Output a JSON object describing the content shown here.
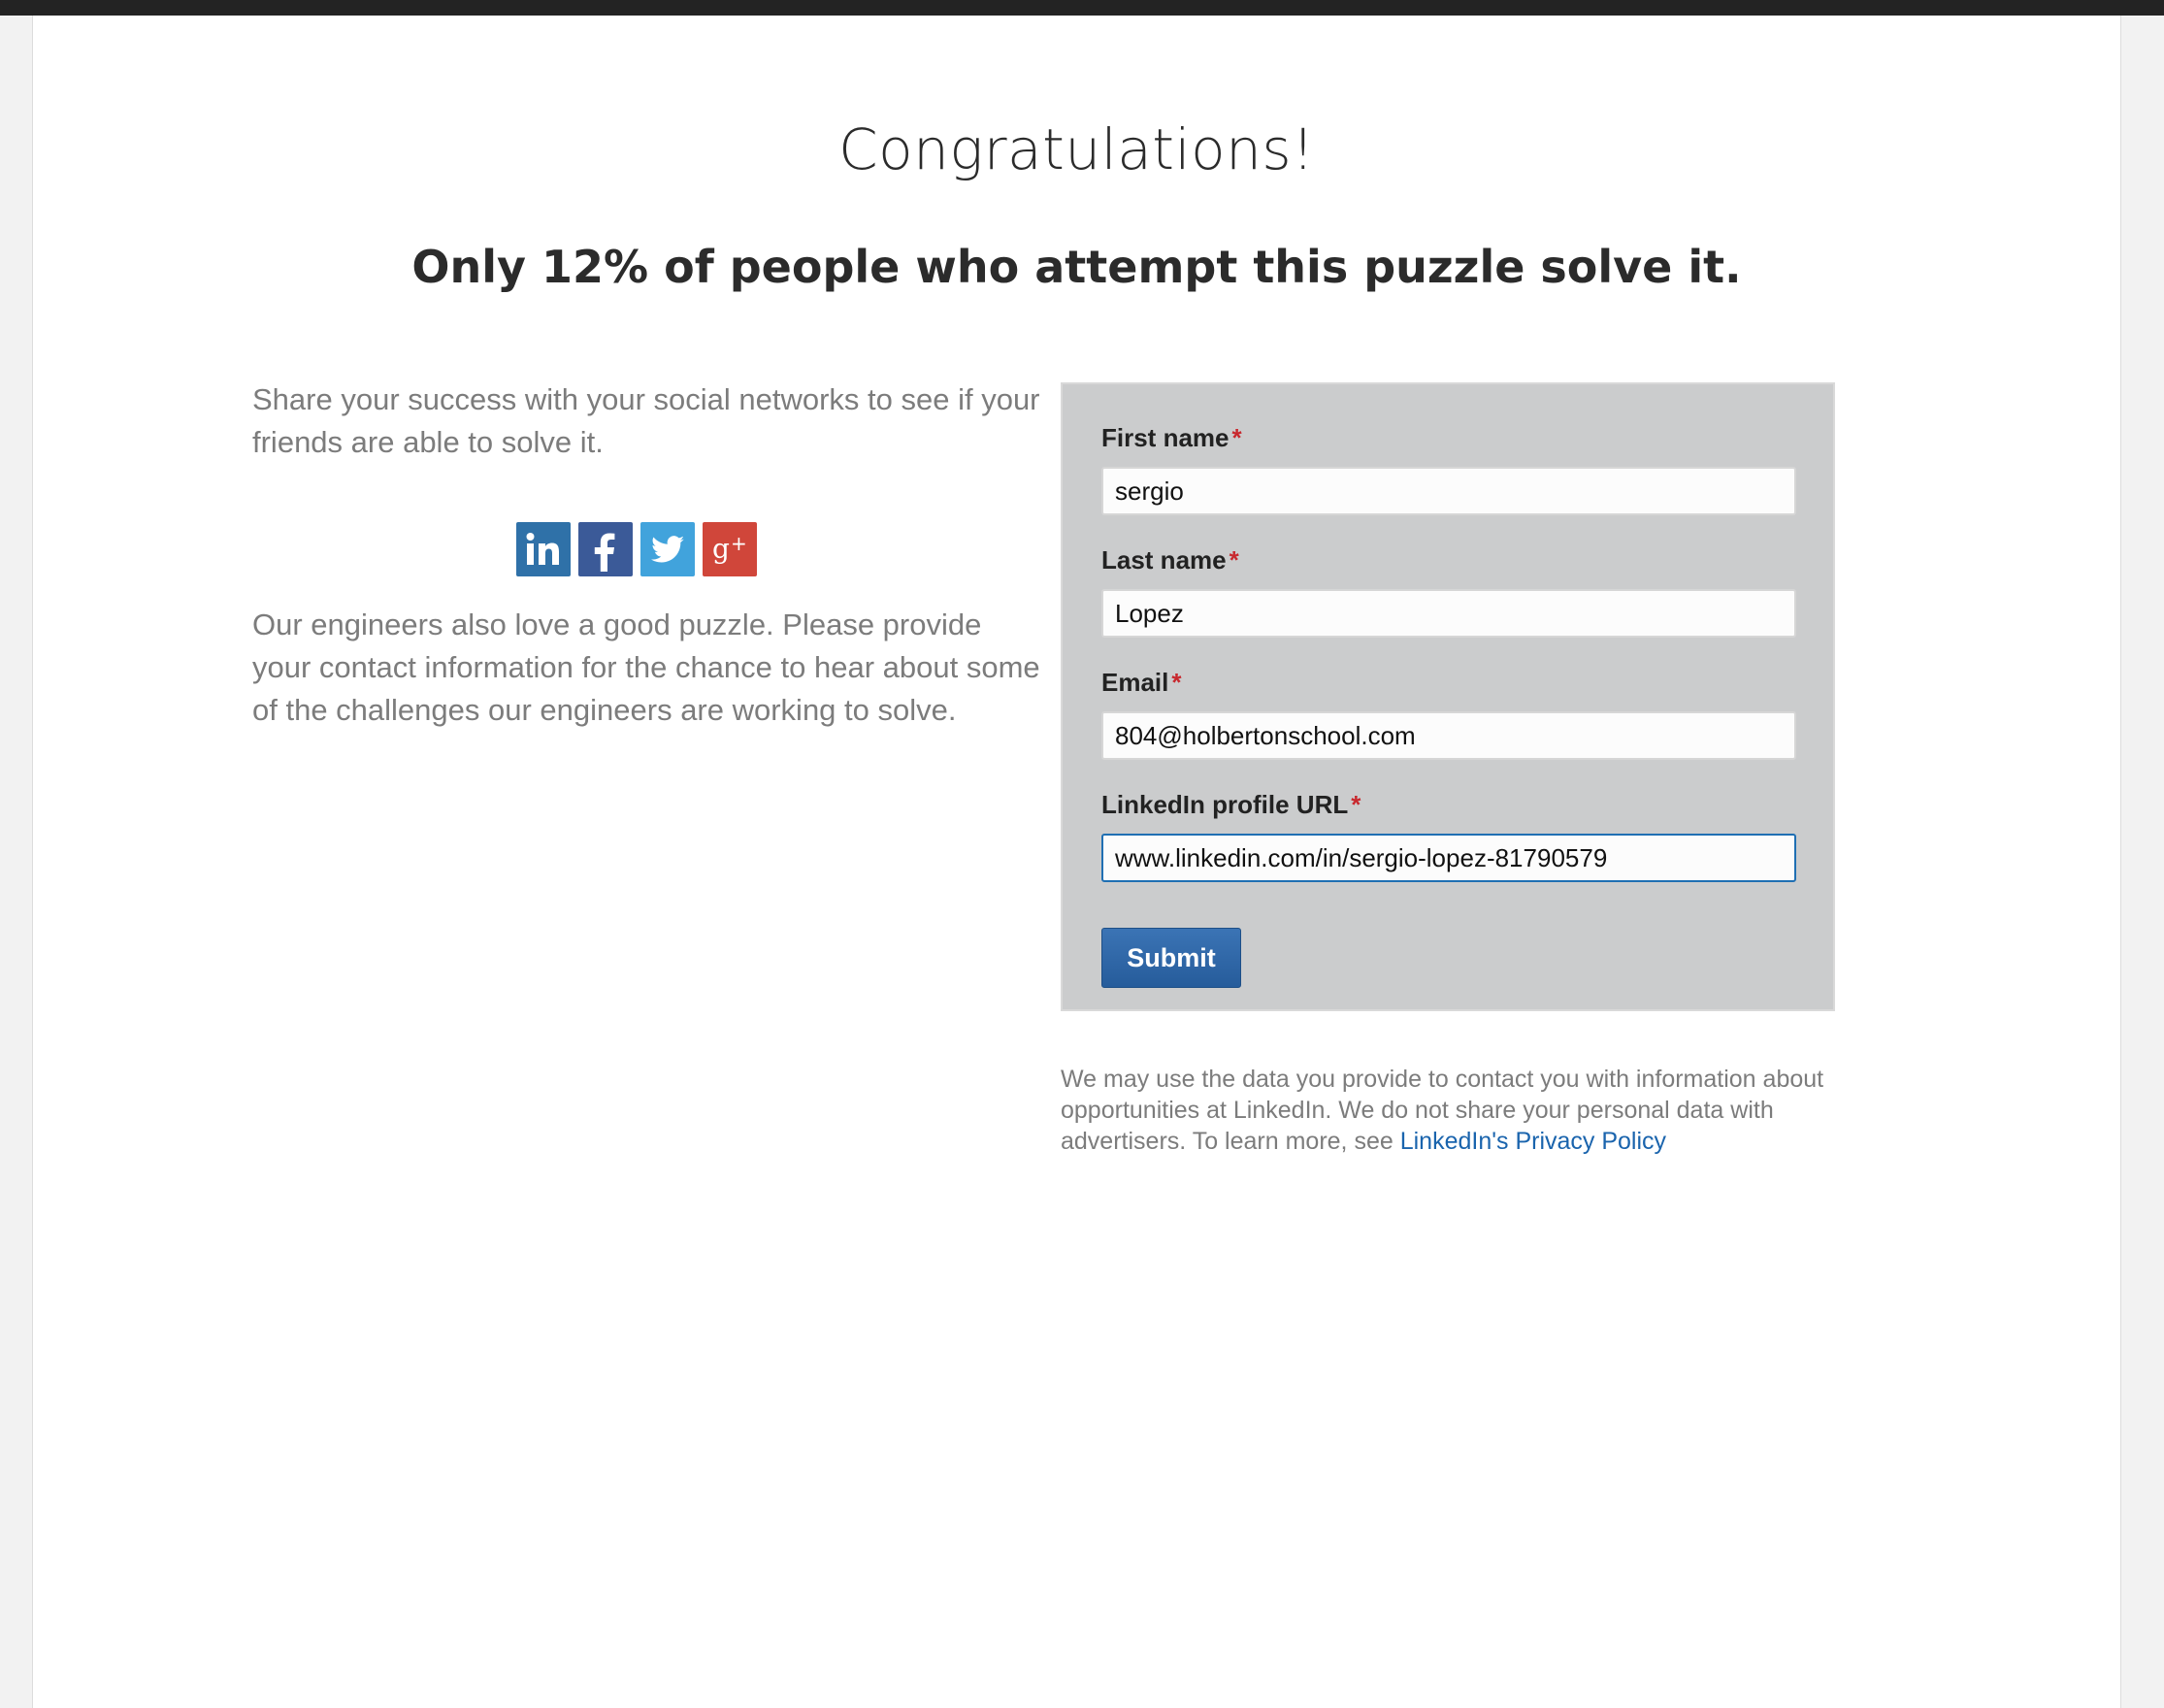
{
  "heading": {
    "title": "Congratulations!",
    "subtitle": "Only 12% of people who attempt this puzzle solve it."
  },
  "left": {
    "share_text": "Share your success with your social networks to see if your friends are able to solve it.",
    "engineers_text": "Our engineers also love a good puzzle. Please provide your contact information for the chance to hear about some of the challenges our engineers are working to solve.",
    "social_icons": [
      "linkedin-icon",
      "facebook-icon",
      "twitter-icon",
      "google-plus-icon"
    ]
  },
  "form": {
    "required_marker": "*",
    "first_name": {
      "label": "First name",
      "value": "sergio"
    },
    "last_name": {
      "label": "Last name",
      "value": "Lopez"
    },
    "email": {
      "label": "Email",
      "value": "804@holbertonschool.com"
    },
    "linkedin_url": {
      "label": "LinkedIn profile URL",
      "value": "www.linkedin.com/in/sergio-lopez-81790579"
    },
    "submit_label": "Submit"
  },
  "disclaimer": {
    "text": "We may use the data you provide to contact you with information about opportunities at LinkedIn. We do not share your personal data with advertisers. To learn more, see",
    "link_text": "LinkedIn's Privacy Policy"
  },
  "colors": {
    "panel_bg": "#cbcccd",
    "button": "#2f66a8",
    "required": "#c8282e",
    "link": "#1a64ad"
  }
}
